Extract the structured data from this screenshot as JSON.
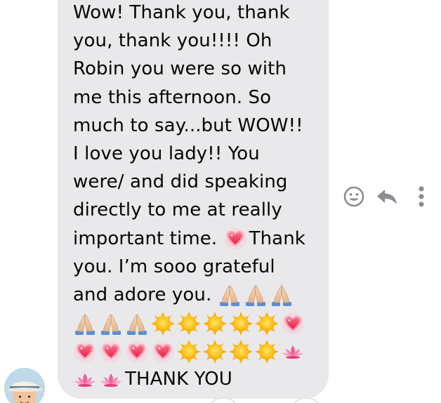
{
  "conversation": {
    "message": {
      "lines": [
        "Wow! Thank you, thank",
        "you, thank you!!!! Oh",
        "Robin you were so with",
        "me this afternoon. So",
        "much to say...but WOW!!",
        "I love you lady!! You",
        "were/ and did speaking",
        "directly to me at really"
      ],
      "line_important": "important time.",
      "line_important_end": "Thank",
      "line_grateful": "you. I’m sooo grateful",
      "line_adore": "and adore you.",
      "closing": "THANK YOU"
    },
    "actions": {
      "react_icon": "smiley-icon",
      "reply_icon": "reply-arrow-icon",
      "more_icon": "more-vertical-icon"
    }
  },
  "emoji": {
    "heart": "sparkling-heart",
    "pray": "folded-hands",
    "sun": "sun",
    "lotus": "lotus"
  },
  "colors": {
    "bubble": "#e9e9ec",
    "text": "#050505",
    "icons": "#8a8d91"
  }
}
